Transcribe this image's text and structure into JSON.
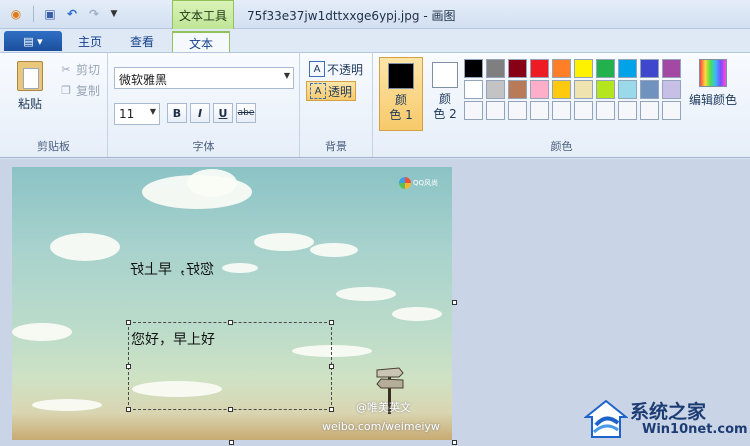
{
  "titlebar": {
    "context_tab_label": "文本工具",
    "window_title": "75f33e37jw1dttxxge6ypj.jpg - 画图"
  },
  "tabs": {
    "home": "主页",
    "view": "查看",
    "text": "文本"
  },
  "clipboard": {
    "paste": "粘贴",
    "cut": "剪切",
    "copy": "复制",
    "group_label": "剪贴板"
  },
  "font": {
    "family": "微软雅黑",
    "size": "11",
    "bold": "B",
    "italic": "I",
    "underline": "U",
    "strikethrough": "abe",
    "group_label": "字体"
  },
  "background": {
    "opaque": "不透明",
    "transparent": "透明",
    "group_label": "背景"
  },
  "colors": {
    "color1_label_line1": "颜",
    "color1_label_line2": "色 1",
    "color2_label_line1": "颜",
    "color2_label_line2": "色 2",
    "color1_value": "#000000",
    "color2_value": "#ffffff",
    "edit_colors": "编辑颜色",
    "group_label": "颜色",
    "palette": [
      [
        "#000000",
        "#7f7f7f",
        "#880015",
        "#ed1c24",
        "#ff7f27",
        "#fff200",
        "#22b14c",
        "#00a2e8",
        "#3f48cc",
        "#a349a4"
      ],
      [
        "#ffffff",
        "#c3c3c3",
        "#b97a57",
        "#ffaec9",
        "#ffc90e",
        "#efe4b0",
        "#b5e61d",
        "#99d9ea",
        "#7092be",
        "#c8bfe7"
      ],
      [
        "#f5f7fa",
        "#f5f7fa",
        "#f5f7fa",
        "#f5f7fa",
        "#f5f7fa",
        "#f5f7fa",
        "#f5f7fa",
        "#f5f7fa",
        "#f5f7fa",
        "#f5f7fa"
      ]
    ]
  },
  "canvas": {
    "mirrored_text": "您好，早上好",
    "text_box": "您好，早上好",
    "qq_watermark": "QQ风尚",
    "weibo_handle": "@唯美英文",
    "weibo_url": "weibo.com/weimeiyw"
  },
  "brand": {
    "name": "系统之家",
    "url": "Win10net.com"
  }
}
